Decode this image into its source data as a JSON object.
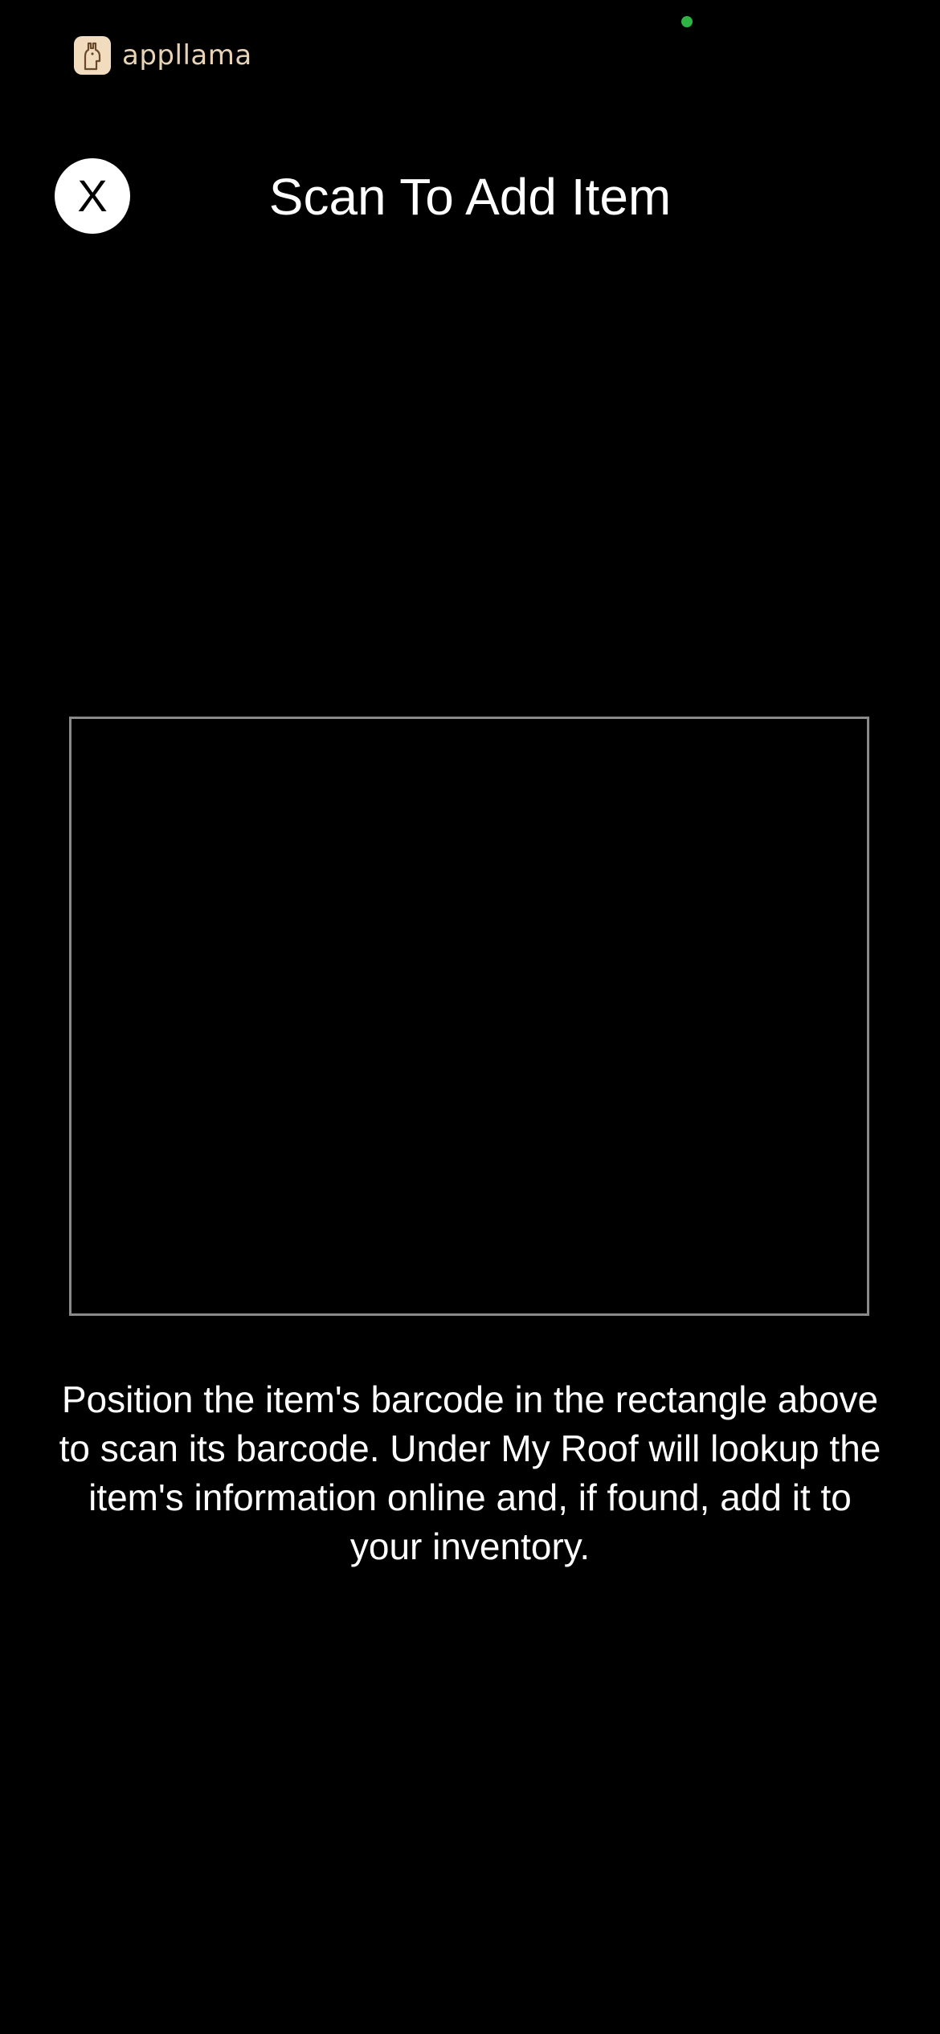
{
  "status_bar": {
    "indicator_color": "#2fb344"
  },
  "brand": {
    "name": "appllama",
    "logo_icon": "llama-icon"
  },
  "header": {
    "close_label": "X",
    "title": "Scan To Add Item"
  },
  "scanner": {
    "frame_color": "#8a8a8a"
  },
  "instructions": {
    "text": "Position the item's barcode in the rectangle above to scan its barcode. Under My Roof will lookup the item's information online and, if found, add it to your inventory."
  }
}
